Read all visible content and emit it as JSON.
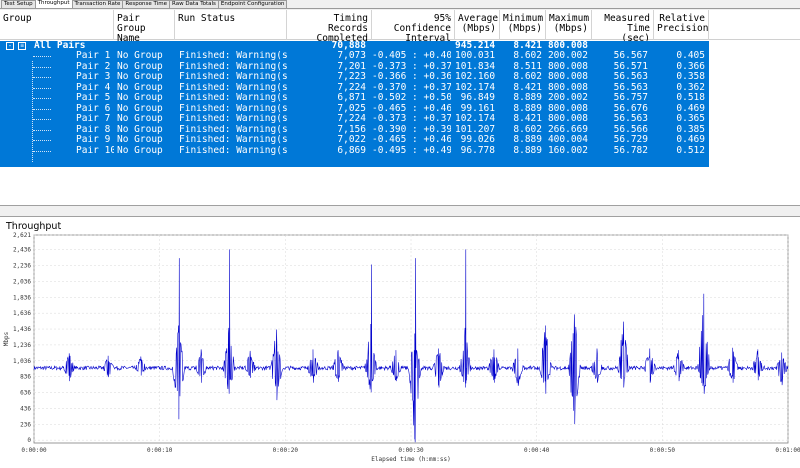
{
  "tabs": [
    {
      "label": "Test Setup",
      "active": false
    },
    {
      "label": "Throughput",
      "active": true
    },
    {
      "label": "Transaction Rate",
      "active": false
    },
    {
      "label": "Response Time",
      "active": false
    },
    {
      "label": "Raw Data Totals",
      "active": false
    },
    {
      "label": "Endpoint Configuration",
      "active": false
    }
  ],
  "table": {
    "headers": {
      "group": "Group",
      "pair_group_name": "Pair Group\nName",
      "run_status": "Run Status",
      "timing_records": "Timing Records\nCompleted",
      "confidence": "95% Confidence\nInterval",
      "average": "Average\n(Mbps)",
      "minimum": "Minimum\n(Mbps)",
      "maximum": "Maximum\n(Mbps)",
      "measured_time": "Measured\nTime (sec)",
      "relative_precision": "Relative\nPrecision"
    },
    "all_pairs": {
      "label": "All Pairs",
      "timing_records": "70,888",
      "average": "945.214",
      "minimum": "8.421",
      "maximum": "800.008"
    },
    "rows": [
      {
        "pair": "Pair 1",
        "group": "No Group",
        "status": "Finished: Warning(s)",
        "records": "7,073",
        "ci": "-0.405 : +0.405",
        "avg": "100.031",
        "min": "8.602",
        "max": "200.002",
        "time": "56.567",
        "prec": "0.405"
      },
      {
        "pair": "Pair 2",
        "group": "No Group",
        "status": "Finished: Warning(s)",
        "records": "7,201",
        "ci": "-0.373 : +0.373",
        "avg": "101.834",
        "min": "8.511",
        "max": "800.008",
        "time": "56.571",
        "prec": "0.366"
      },
      {
        "pair": "Pair 3",
        "group": "No Group",
        "status": "Finished: Warning(s)",
        "records": "7,223",
        "ci": "-0.366 : +0.366",
        "avg": "102.160",
        "min": "8.602",
        "max": "800.008",
        "time": "56.563",
        "prec": "0.358"
      },
      {
        "pair": "Pair 4",
        "group": "No Group",
        "status": "Finished: Warning(s)",
        "records": "7,224",
        "ci": "-0.370 : +0.370",
        "avg": "102.174",
        "min": "8.421",
        "max": "800.008",
        "time": "56.563",
        "prec": "0.362"
      },
      {
        "pair": "Pair 5",
        "group": "No Group",
        "status": "Finished: Warning(s)",
        "records": "6,871",
        "ci": "-0.502 : +0.502",
        "avg": "96.849",
        "min": "8.889",
        "max": "200.002",
        "time": "56.757",
        "prec": "0.518"
      },
      {
        "pair": "Pair 6",
        "group": "No Group",
        "status": "Finished: Warning(s)",
        "records": "7,025",
        "ci": "-0.465 : +0.465",
        "avg": "99.161",
        "min": "8.889",
        "max": "800.008",
        "time": "56.676",
        "prec": "0.469"
      },
      {
        "pair": "Pair 7",
        "group": "No Group",
        "status": "Finished: Warning(s)",
        "records": "7,224",
        "ci": "-0.373 : +0.373",
        "avg": "102.174",
        "min": "8.421",
        "max": "800.008",
        "time": "56.563",
        "prec": "0.365"
      },
      {
        "pair": "Pair 8",
        "group": "No Group",
        "status": "Finished: Warning(s)",
        "records": "7,156",
        "ci": "-0.390 : +0.390",
        "avg": "101.207",
        "min": "8.602",
        "max": "266.669",
        "time": "56.566",
        "prec": "0.385"
      },
      {
        "pair": "Pair 9",
        "group": "No Group",
        "status": "Finished: Warning(s)",
        "records": "7,022",
        "ci": "-0.465 : +0.465",
        "avg": "99.026",
        "min": "8.889",
        "max": "400.004",
        "time": "56.729",
        "prec": "0.469"
      },
      {
        "pair": "Pair 10",
        "group": "No Group",
        "status": "Finished: Warning(s)",
        "records": "6,869",
        "ci": "-0.495 : +0.495",
        "avg": "96.778",
        "min": "8.889",
        "max": "160.002",
        "time": "56.782",
        "prec": "0.512"
      }
    ]
  },
  "chart_data": {
    "type": "line",
    "title": "Throughput",
    "xlabel": "Elapsed time (h:mm:ss)",
    "ylabel": "Mbps",
    "yticks": [
      "0",
      "236",
      "436",
      "636",
      "836",
      "1,036",
      "1,236",
      "1,436",
      "1,636",
      "1,836",
      "2,036",
      "2,236",
      "2,436",
      "2,621"
    ],
    "ytick_values": [
      36,
      236,
      436,
      636,
      836,
      1036,
      1236,
      1436,
      1636,
      1836,
      2036,
      2236,
      2436,
      2621
    ],
    "xticks": [
      "0:00:00",
      "0:00:10",
      "0:00:20",
      "0:00:30",
      "0:00:40",
      "0:00:50",
      "0:01:00"
    ],
    "ylim": [
      0,
      2621
    ],
    "xlim_seconds": [
      0,
      60
    ],
    "baseline_mbps": 945,
    "noise_mbps": 25,
    "bursts": [
      {
        "t": 2.8,
        "hi": 1130,
        "lo": 780
      },
      {
        "t": 5.9,
        "hi": 1100,
        "lo": 830
      },
      {
        "t": 8.5,
        "hi": 1090,
        "lo": 850
      },
      {
        "t": 11.5,
        "hi": 1480,
        "lo": 300,
        "spike": 2330
      },
      {
        "t": 13.3,
        "hi": 1180,
        "lo": 760
      },
      {
        "t": 15.5,
        "hi": 1450,
        "lo": 620,
        "spike": 2440
      },
      {
        "t": 17.2,
        "hi": 1160,
        "lo": 820
      },
      {
        "t": 19.3,
        "hi": 1430,
        "lo": 540
      },
      {
        "t": 22.2,
        "hi": 1180,
        "lo": 760
      },
      {
        "t": 24.2,
        "hi": 1170,
        "lo": 770
      },
      {
        "t": 26.8,
        "hi": 1500,
        "lo": 640,
        "spike": 2250
      },
      {
        "t": 28.8,
        "hi": 1170,
        "lo": 780
      },
      {
        "t": 30.3,
        "hi": 1380,
        "lo": 10,
        "spike": 2330
      },
      {
        "t": 32.2,
        "hi": 1190,
        "lo": 700
      },
      {
        "t": 34.3,
        "hi": 1450,
        "lo": 700,
        "spike": 2440
      },
      {
        "t": 36.6,
        "hi": 1180,
        "lo": 760
      },
      {
        "t": 38.5,
        "hi": 1190,
        "lo": 720
      },
      {
        "t": 40.7,
        "hi": 1480,
        "lo": 620
      },
      {
        "t": 43.0,
        "hi": 1620,
        "lo": 240
      },
      {
        "t": 44.8,
        "hi": 1190,
        "lo": 760
      },
      {
        "t": 46.9,
        "hi": 1530,
        "lo": 700
      },
      {
        "t": 49.0,
        "hi": 1190,
        "lo": 760
      },
      {
        "t": 51.3,
        "hi": 1170,
        "lo": 780
      },
      {
        "t": 53.3,
        "hi": 1880,
        "lo": 620
      },
      {
        "t": 55.6,
        "hi": 1200,
        "lo": 760
      },
      {
        "t": 57.6,
        "hi": 1180,
        "lo": 790
      },
      {
        "t": 59.5,
        "hi": 1140,
        "lo": 730
      }
    ],
    "line_color": "#0000cc",
    "grid": true
  },
  "colors": {
    "selection": "#0078d7",
    "line": "#0000cc"
  }
}
